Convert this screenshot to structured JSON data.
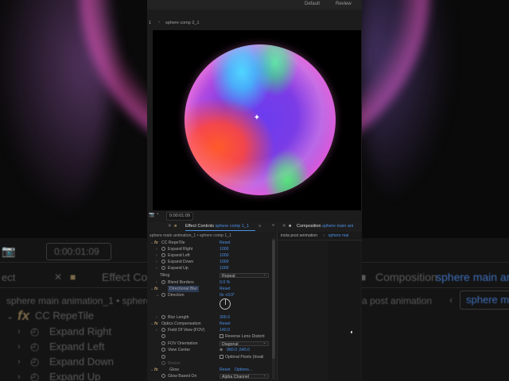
{
  "top_bar": {
    "workspace_default": "Default",
    "workspace_review": "Review"
  },
  "comp_viewer": {
    "nav_marker": "1",
    "breadcrumb": "sphere comp 2_1",
    "timecode": "0:00:01:09"
  },
  "panels": {
    "effect_controls_label": "Effect Controls",
    "effect_controls_layer": "sphere comp 1_1",
    "composition_label": "Composition",
    "composition_name": "sphere main ani",
    "composition_sub_left": "insta post animation",
    "composition_sub_right": "sphere mai",
    "expand_arrows": "»"
  },
  "effect_controls": {
    "title": "sphere main animation_1 • sphere comp 1_1",
    "rows": [
      {
        "type": "effect",
        "name": "CC RepeTile",
        "value": "Reset"
      },
      {
        "type": "param",
        "name": "Expand Right",
        "value": "1000"
      },
      {
        "type": "param",
        "name": "Expand Left",
        "value": "1000"
      },
      {
        "type": "param",
        "name": "Expand Down",
        "value": "1000"
      },
      {
        "type": "param",
        "name": "Expand Up",
        "value": "1000"
      },
      {
        "type": "select",
        "name": "Tiling",
        "value": "Repeat"
      },
      {
        "type": "param",
        "name": "Blend Borders",
        "value": "0.0 %"
      },
      {
        "type": "effect",
        "name": "Directional Blur",
        "value": "Reset",
        "highlight": true
      },
      {
        "type": "param",
        "name": "Direction",
        "value": "0x +0.0°"
      },
      {
        "type": "dial"
      },
      {
        "type": "param",
        "name": "Blur Length",
        "value": "300.0"
      },
      {
        "type": "effect",
        "name": "Optics Compensation",
        "value": "Reset"
      },
      {
        "type": "param",
        "name": "Field Of View (FOV)",
        "value": "140.0"
      },
      {
        "type": "check",
        "name": "",
        "value": "Reverse Lens Distorti"
      },
      {
        "type": "select",
        "name": "FOV Orientation",
        "value": "Diagonal"
      },
      {
        "type": "point",
        "name": "View Center",
        "value": "960.0 ,540.0"
      },
      {
        "type": "check",
        "name": "",
        "value": "Optimal Pixels (Invali"
      },
      {
        "type": "param",
        "name": "Resize",
        "value": ""
      },
      {
        "type": "effect2",
        "name": "Glow",
        "value": "Reset",
        "value2": "Options..."
      },
      {
        "type": "select",
        "name": "Glow Based On",
        "value": "Alpha Channel"
      }
    ]
  },
  "background": {
    "tab_partial": "ect",
    "effect_controls_blur": "Effect Con",
    "composition_blur": "Composition",
    "composition_name_blur": "sphere main an",
    "title_blur": "sphere main animation_1 • sphere",
    "timecode_blur": "0:00:01:09",
    "sub_blur": "a post animation",
    "sub_right_blur": "sphere m",
    "fx_name": "CC RepeTile",
    "rows": [
      "Expand Right",
      "Expand Left",
      "Expand Down",
      "Expand Up"
    ]
  },
  "colors": {
    "accent_blue": "#4b8fe6",
    "panel_bg": "#1c1c1c",
    "viewer_bg": "#000000"
  }
}
